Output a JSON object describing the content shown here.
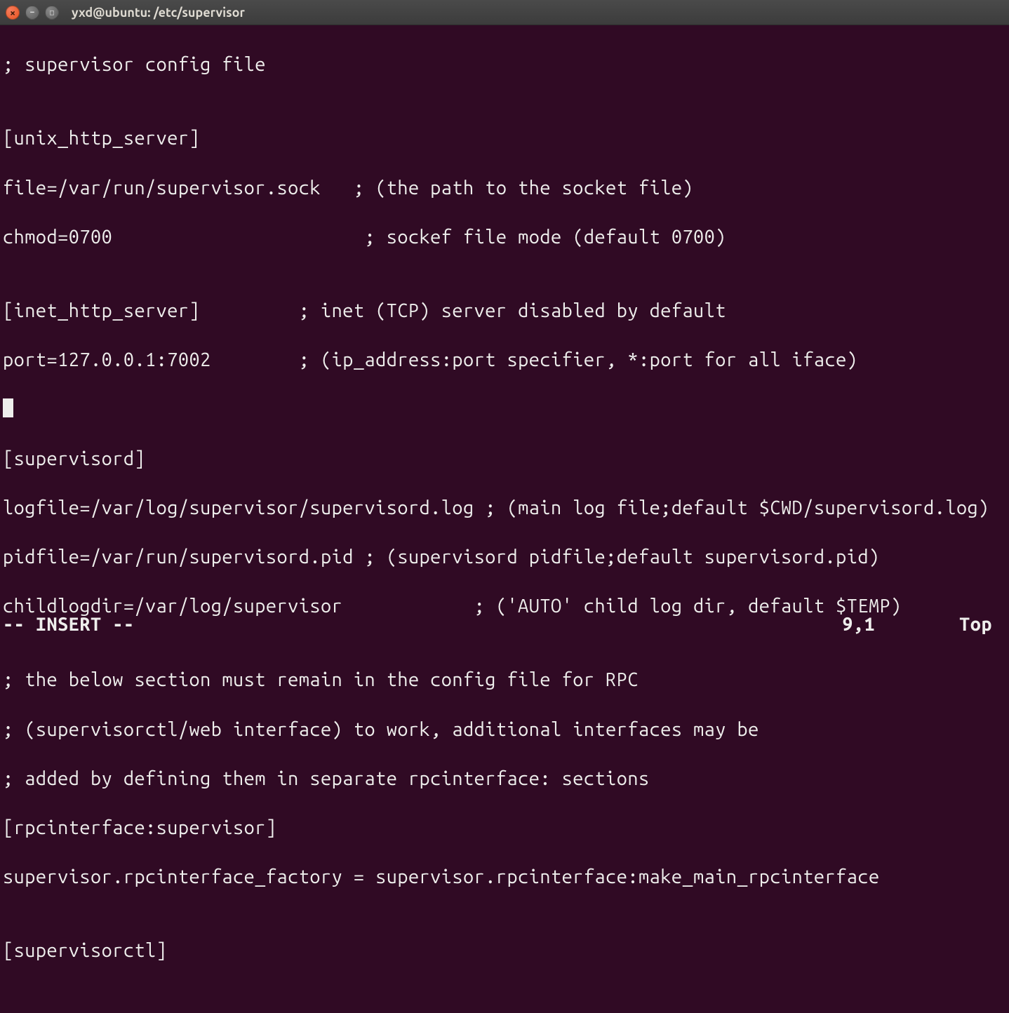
{
  "window": {
    "title": "yxd@ubuntu: /etc/supervisor"
  },
  "editor": {
    "lines": {
      "l1": "; supervisor config file",
      "l2": "",
      "l3": "[unix_http_server]",
      "l4": "file=/var/run/supervisor.sock   ; (the path to the socket file)",
      "l5": "chmod=0700                       ; sockef file mode (default 0700)",
      "l6": "",
      "l7": "[inet_http_server]         ; inet (TCP) server disabled by default",
      "l8": "port=127.0.0.1:7002        ; (ip_address:port specifier, *:port for all iface)",
      "l9": "",
      "l10": "[supervisord]",
      "l11": "logfile=/var/log/supervisor/supervisord.log ; (main log file;default $CWD/supervisord.log)",
      "l12": "pidfile=/var/run/supervisord.pid ; (supervisord pidfile;default supervisord.pid)",
      "l13": "childlogdir=/var/log/supervisor            ; ('AUTO' child log dir, default $TEMP)",
      "l14": "",
      "l15": "; the below section must remain in the config file for RPC",
      "l16": "; (supervisorctl/web interface) to work, additional interfaces may be",
      "l17": "; added by defining them in separate rpcinterface: sections",
      "l18": "[rpcinterface:supervisor]",
      "l19": "supervisor.rpcinterface_factory = supervisor.rpcinterface:make_main_rpcinterface",
      "l20": "",
      "l21": "[supervisorctl]"
    },
    "status": {
      "mode": "-- INSERT --",
      "position": "9,1",
      "scroll": "Top"
    }
  }
}
